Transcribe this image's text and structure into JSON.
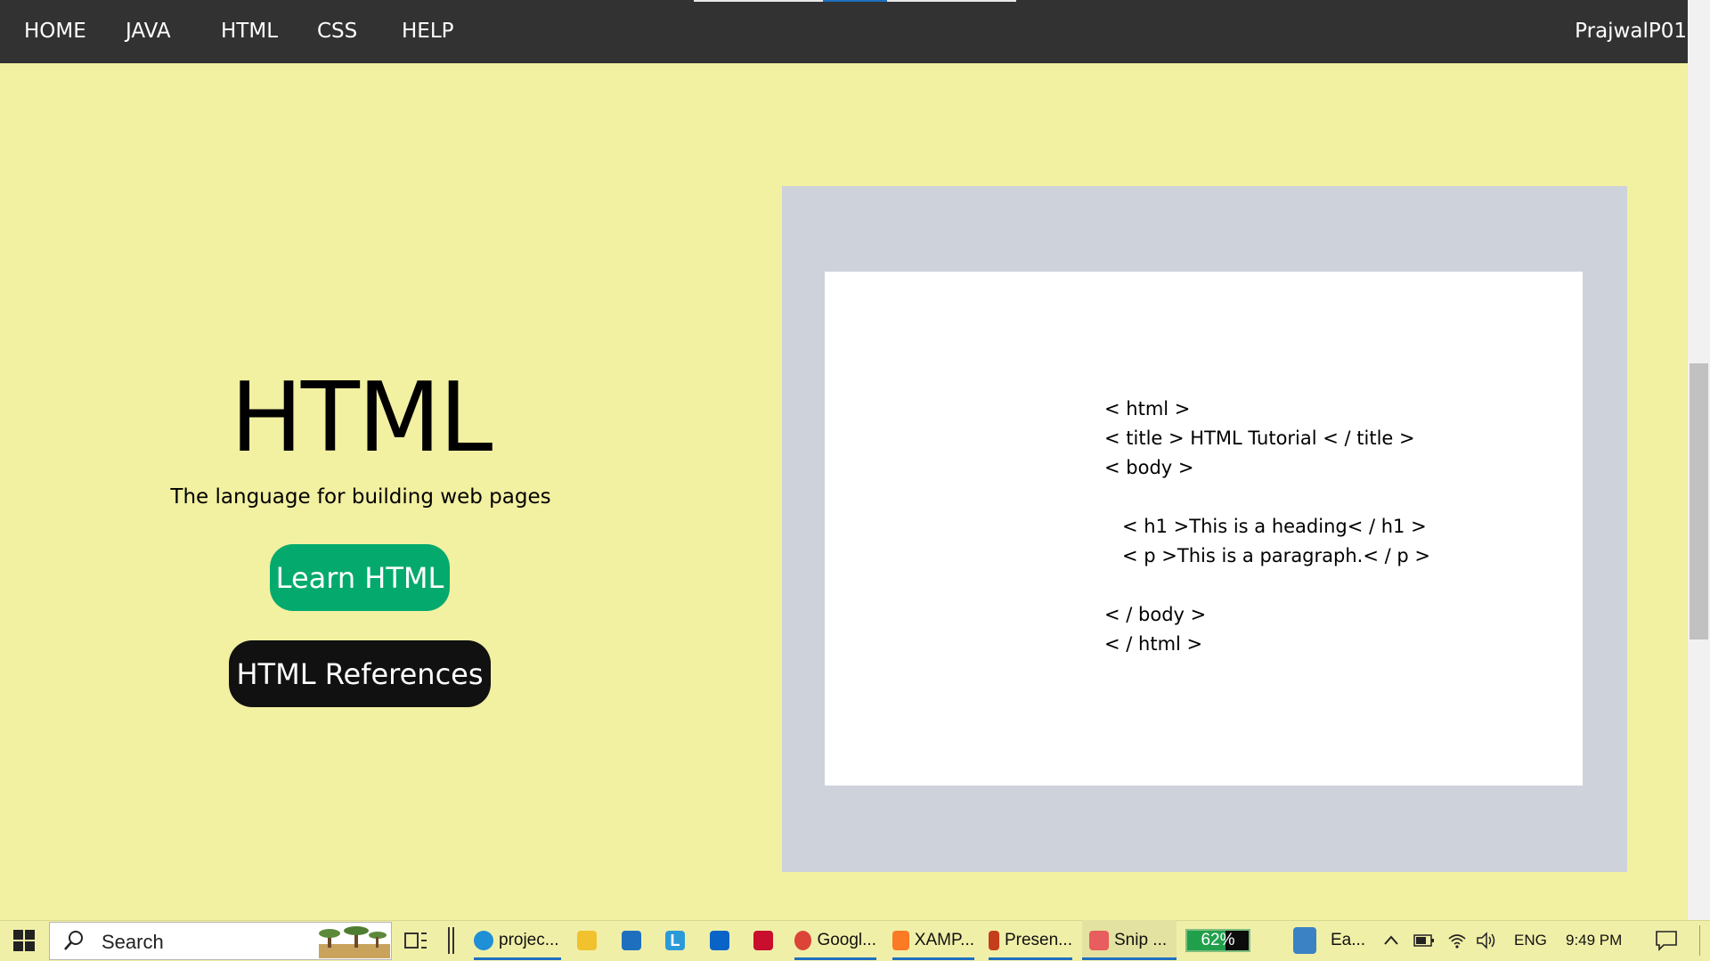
{
  "nav": {
    "items": [
      "HOME",
      "JAVA",
      "HTML",
      "CSS",
      "HELP"
    ],
    "user": "PrajwalP01"
  },
  "hero": {
    "title": "HTML",
    "subtitle": "The language for building web pages",
    "learn_button": "Learn HTML",
    "ref_button": "HTML References"
  },
  "code_example": {
    "lines": [
      "< html >",
      "< title > HTML Tutorial < / title >",
      "< body >",
      "",
      "   < h1 >This is a heading< / h1 >",
      "   < p >This is a paragraph.< / p >",
      "",
      "< / body >",
      "< / html >"
    ]
  },
  "taskbar": {
    "search_placeholder": "Search",
    "apps": [
      {
        "label": "projec...",
        "icon": "edge-icon",
        "color": "#1f8fd6"
      },
      {
        "label": "",
        "icon": "file-explorer-icon",
        "color": "#f2c12e"
      },
      {
        "label": "",
        "icon": "mail-icon",
        "color": "#1f6fbf"
      },
      {
        "label": "",
        "icon": "launcher-l-icon",
        "color": "#2d9ad8"
      },
      {
        "label": "",
        "icon": "outlook-icon",
        "color": "#0a64c8"
      },
      {
        "label": "",
        "icon": "mcafee-icon",
        "color": "#c8102e"
      },
      {
        "label": "Googl...",
        "icon": "chrome-icon",
        "color": "#db4437"
      },
      {
        "label": "XAMP...",
        "icon": "xampp-icon",
        "color": "#fb7a24"
      },
      {
        "label": "Presen...",
        "icon": "powerpoint-icon",
        "color": "#c43e1c"
      },
      {
        "label": "Snip ...",
        "icon": "snip-icon",
        "color": "#e85d5d"
      }
    ],
    "battery_percent": "62%",
    "battery_level": 0.62,
    "weather_label": "Ea...",
    "language": "ENG",
    "time": "9:49 PM"
  }
}
